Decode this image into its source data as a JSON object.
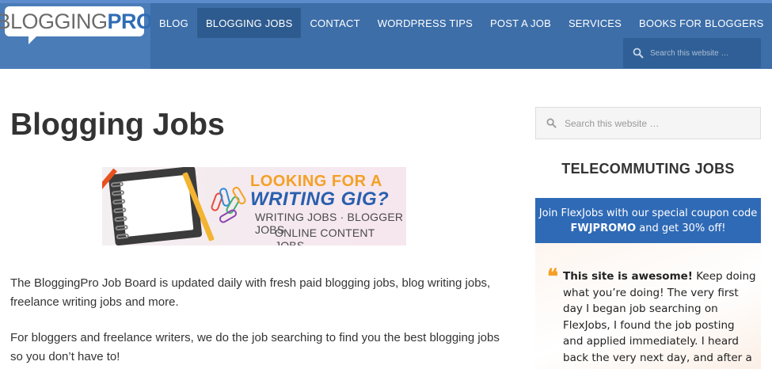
{
  "brand": {
    "logo_part1": "BLOGGING",
    "logo_part2": "PRO"
  },
  "nav": {
    "items": [
      {
        "label": "BLOG"
      },
      {
        "label": "BLOGGING JOBS",
        "active": true
      },
      {
        "label": "CONTACT"
      },
      {
        "label": "WORDPRESS TIPS"
      },
      {
        "label": "POST A JOB"
      },
      {
        "label": "SERVICES"
      },
      {
        "label": "BOOKS FOR BLOGGERS"
      }
    ],
    "search_placeholder": "Search this website …"
  },
  "main": {
    "title": "Blogging Jobs",
    "banner": {
      "line1": "LOOKING FOR A",
      "line2": "WRITING GIG?",
      "line3": "WRITING JOBS · BLOGGER JOBS",
      "line4": "ONLINE CONTENT JOBS"
    },
    "paragraphs": [
      "The BloggingPro Job Board is updated daily with fresh paid blogging jobs, blog writing jobs, freelance writing jobs and more.",
      "For bloggers and freelance writers, we do the job searching to find you the best blogging jobs so you don’t have to!"
    ]
  },
  "sidebar": {
    "search_placeholder": "Search this website …",
    "widget_title": "TELECOMMUTING JOBS",
    "promo": {
      "text_before_code": "Join FlexJobs with our special coupon code ",
      "code": "FWJPROMO",
      "text_after_code": " and get 30% off!"
    },
    "testimonial": {
      "quote_mark": "❝",
      "lead": "This site is awesome!",
      "body": " Keep doing what you’re doing! The very first day I began job searching on FlexJobs, I found the job posting and applied immediately. I heard back the very next day, and after a successful"
    }
  },
  "colors": {
    "header_bg": "#4a7cb8",
    "nav_bg": "#3d6ea8",
    "nav_active": "#2e5b8f",
    "promo_bg": "#2f6ab6",
    "accent_orange": "#f4a025"
  }
}
